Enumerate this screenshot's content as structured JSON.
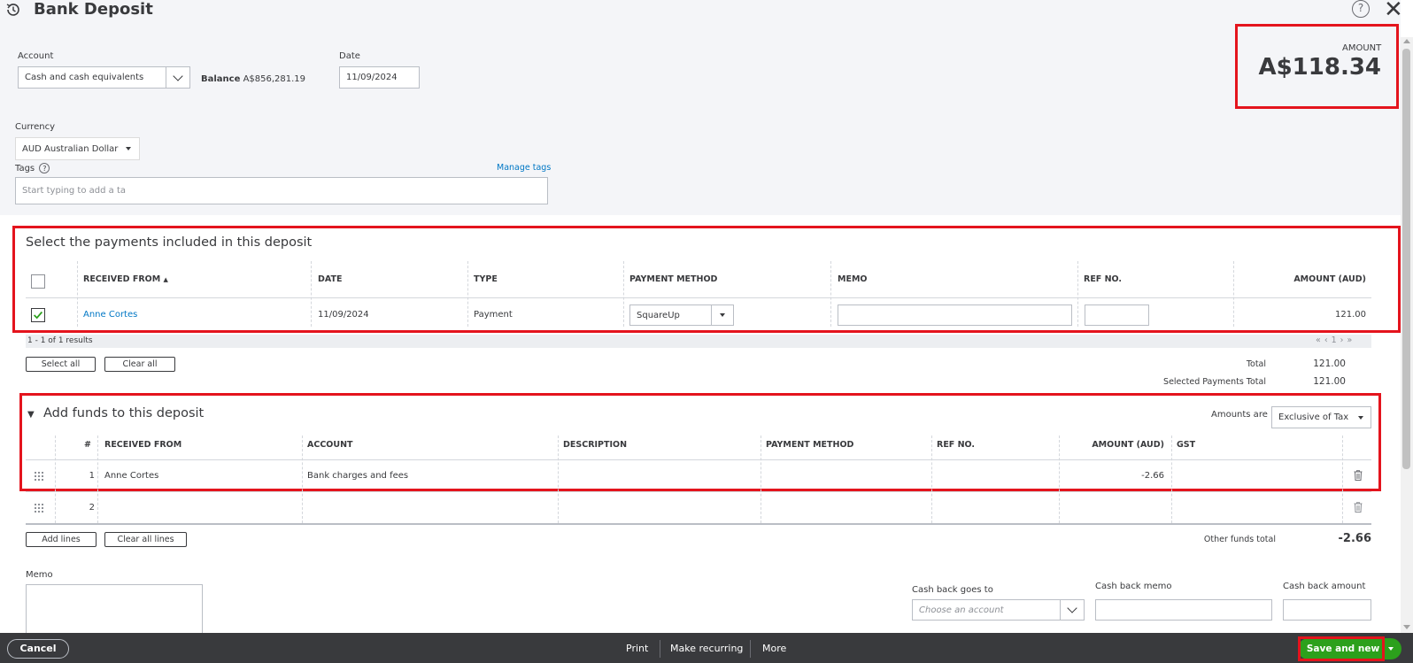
{
  "header": {
    "title": "Bank Deposit",
    "help_label": "?",
    "amount_label": "AMOUNT",
    "amount_value": "A$118.34"
  },
  "form": {
    "account_label": "Account",
    "account_value": "Cash and cash equivalents",
    "balance_label": "Balance",
    "balance_value": "A$856,281.19",
    "date_label": "Date",
    "date_value": "11/09/2024",
    "currency_label": "Currency",
    "currency_value": "AUD Australian Dollar",
    "tags_label": "Tags",
    "tags_help": "?",
    "manage_tags": "Manage tags",
    "tags_placeholder": "Start typing to add a ta"
  },
  "payments": {
    "title": "Select the payments included in this deposit",
    "columns": {
      "received_from": "RECEIVED FROM",
      "sort_indicator": "▲",
      "date": "DATE",
      "type": "TYPE",
      "payment_method": "PAYMENT METHOD",
      "memo": "MEMO",
      "ref_no": "REF NO.",
      "amount": "AMOUNT (AUD)"
    },
    "rows": [
      {
        "checked": true,
        "received_from": "Anne Cortes",
        "date": "11/09/2024",
        "type": "Payment",
        "payment_method": "SquareUp",
        "memo": "",
        "ref_no": "",
        "amount": "121.00"
      }
    ],
    "results_text": "1 - 1 of 1 results",
    "pager": {
      "first": "«",
      "prev": "‹",
      "page": "1",
      "next": "›",
      "last": "»"
    },
    "select_all": "Select all",
    "clear_all": "Clear all",
    "total_label": "Total",
    "total_value": "121.00",
    "selected_total_label": "Selected Payments Total",
    "selected_total_value": "121.00"
  },
  "funds": {
    "title": "Add funds to this deposit",
    "toggle_icon": "▼",
    "amounts_are_label": "Amounts are",
    "amounts_are_value": "Exclusive of Tax",
    "columns": {
      "num": "#",
      "received_from": "RECEIVED FROM",
      "account": "ACCOUNT",
      "description": "DESCRIPTION",
      "payment_method": "PAYMENT METHOD",
      "ref_no": "REF NO.",
      "amount": "AMOUNT (AUD)",
      "gst": "GST"
    },
    "rows": [
      {
        "num": "1",
        "received_from": "Anne Cortes",
        "account": "Bank charges and fees",
        "description": "",
        "payment_method": "",
        "ref_no": "",
        "amount": "-2.66",
        "gst": ""
      },
      {
        "num": "2",
        "received_from": "",
        "account": "",
        "description": "",
        "payment_method": "",
        "ref_no": "",
        "amount": "",
        "gst": ""
      }
    ],
    "add_lines": "Add lines",
    "clear_all_lines": "Clear all lines",
    "other_total_label": "Other funds total",
    "other_total_value": "-2.66"
  },
  "bottom": {
    "memo_label": "Memo",
    "cash_back_to_label": "Cash back goes to",
    "cash_back_to_placeholder": "Choose an account",
    "cash_back_memo_label": "Cash back memo",
    "cash_back_amount_label": "Cash back amount"
  },
  "footer": {
    "cancel": "Cancel",
    "print": "Print",
    "make_recurring": "Make recurring",
    "more": "More",
    "save_and_new": "Save and new"
  },
  "colors": {
    "link": "#0077c5",
    "primary_button": "#2ca01c",
    "highlight": "#e4141d",
    "footer_bg": "#393a3d"
  }
}
